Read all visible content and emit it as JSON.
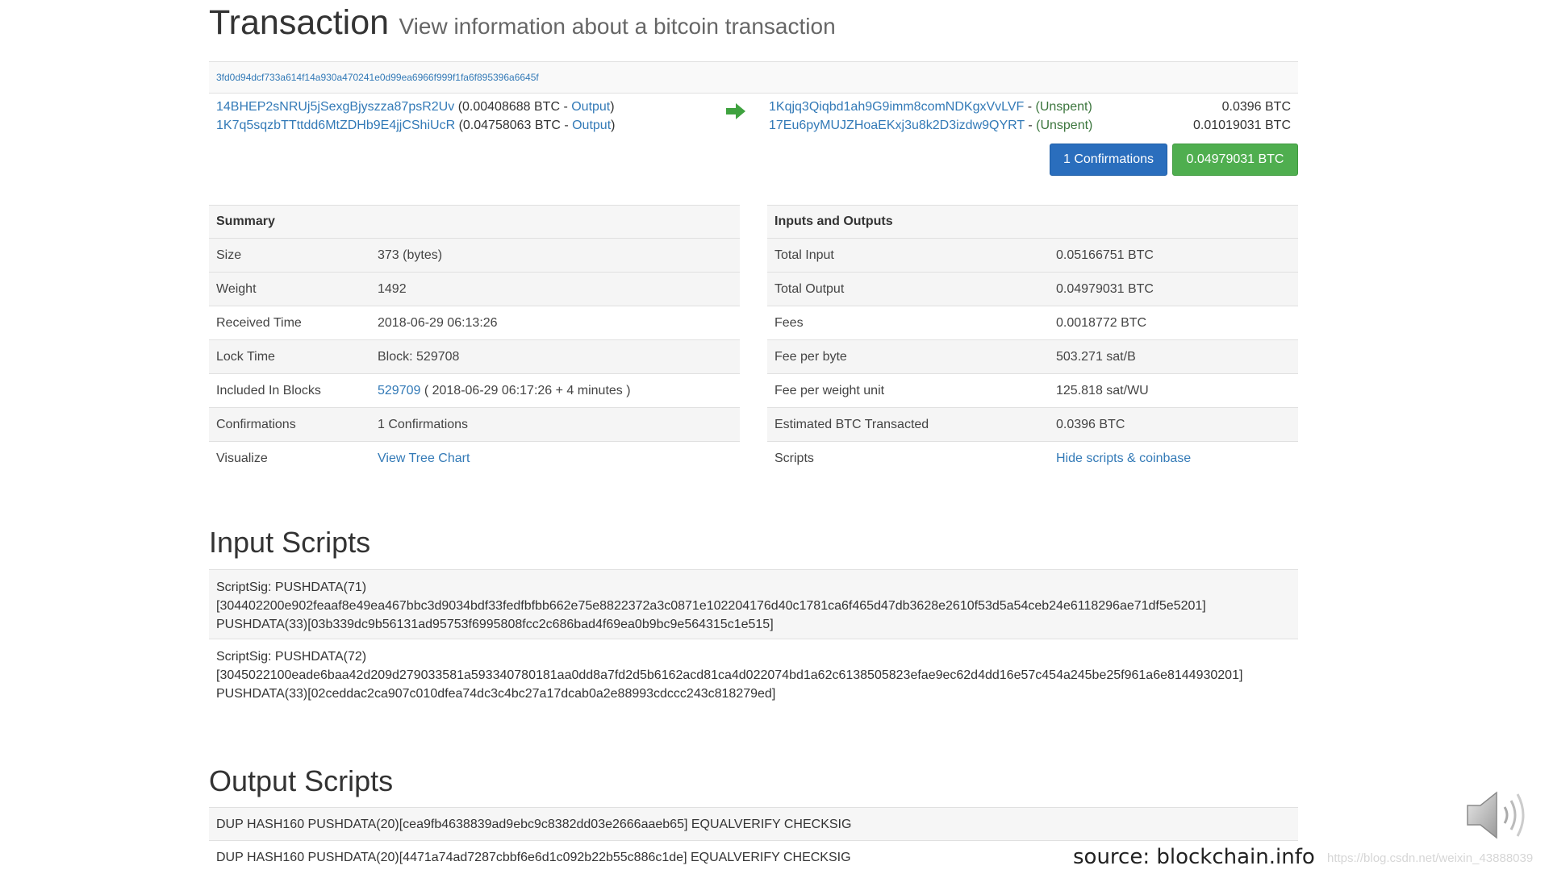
{
  "header": {
    "title": "Transaction",
    "subtitle": "View information about a bitcoin transaction"
  },
  "tx": {
    "hash": "3fd0d94dcf733a614f14a930a470241e0d99ea6966f999f1fa6f895396a6645f",
    "inputs": [
      {
        "address": "14BHEP2sNRUj5jSexgBjyszza87psR2Uv",
        "amount_text": "(0.00408688 BTC - ",
        "link_label": "Output",
        "close": ")"
      },
      {
        "address": "1K7q5sqzbTTttdd6MtZDHb9E4jjCShiUcR",
        "amount_text": "(0.04758063 BTC - ",
        "link_label": "Output",
        "close": ")"
      }
    ],
    "outputs": [
      {
        "address": "1Kqjq3Qiqbd1ah9G9imm8comNDKgxVvLVF",
        "sep": " - ",
        "status": "(Unspent)",
        "amount": "0.0396 BTC"
      },
      {
        "address": "17Eu6pyMUJZHoaEKxj3u8k2D3izdw9QYRT",
        "sep": " - ",
        "status": "(Unspent)",
        "amount": "0.01019031 BTC"
      }
    ],
    "confirmations_button": "1 Confirmations",
    "total_button": "0.04979031 BTC",
    "arrow_icon": "arrow-right-icon",
    "colors": {
      "primary": "#2a6ebd",
      "success": "#4fae4f",
      "link": "#337ab7",
      "green_text": "#3c763d"
    }
  },
  "summary": {
    "heading": "Summary",
    "rows": [
      {
        "label": "Size",
        "value": "373 (bytes)"
      },
      {
        "label": "Weight",
        "value": "1492"
      },
      {
        "label": "Received Time",
        "value": "2018-06-29 06:13:26"
      },
      {
        "label": "Lock Time",
        "value": "Block: 529708"
      },
      {
        "label": "Included In Blocks",
        "value_link": "529709",
        "value": " ( 2018-06-29 06:17:26 + 4 minutes )"
      },
      {
        "label": "Confirmations",
        "value": "1 Confirmations"
      },
      {
        "label": "Visualize",
        "value_link": "View Tree Chart",
        "value": ""
      }
    ]
  },
  "inputs_outputs": {
    "heading": "Inputs and Outputs",
    "rows": [
      {
        "label": "Total Input",
        "value": "0.05166751 BTC"
      },
      {
        "label": "Total Output",
        "value": "0.04979031 BTC"
      },
      {
        "label": "Fees",
        "value": "0.0018772 BTC"
      },
      {
        "label": "Fee per byte",
        "value": "503.271 sat/B"
      },
      {
        "label": "Fee per weight unit",
        "value": "125.818 sat/WU"
      },
      {
        "label": "Estimated BTC Transacted",
        "value": "0.0396 BTC"
      },
      {
        "label": "Scripts",
        "value_link": "Hide scripts & coinbase",
        "value": ""
      }
    ]
  },
  "input_scripts": {
    "title": "Input Scripts",
    "blocks": [
      {
        "line1": "ScriptSig: PUSHDATA(71)",
        "line2": "[304402200e902feaaf8e49ea467bbc3d9034bdf33fedfbfbb662e75e8822372a3c0871e102204176d40c1781ca6f465d47db3628e2610f53d5a54ceb24e6118296ae71df5e5201]",
        "line3": "PUSHDATA(33)[03b339dc9b56131ad95753f6995808fcc2c686bad4f69ea0b9bc9e564315c1e515]"
      },
      {
        "line1": "ScriptSig: PUSHDATA(72)",
        "line2": "[3045022100eade6baa42d209d279033581a593340780181aa0dd8a7fd2d5b6162acd81ca4d022074bd1a62c6138505823efae9ec62d4dd16e57c454a245be25f961a6e8144930201]",
        "line3": "PUSHDATA(33)[02ceddac2ca907c010dfea74dc3c4bc27a17dcab0a2e88993cdccc243c818279ed]"
      }
    ]
  },
  "output_scripts": {
    "title": "Output Scripts",
    "rows": [
      "DUP HASH160 PUSHDATA(20)[cea9fb4638839ad9ebc9c8382dd03e2666aaeb65] EQUALVERIFY CHECKSIG",
      "DUP HASH160 PUSHDATA(20)[4471a74ad7287cbbf6e6d1c092b22b55c886c1de] EQUALVERIFY CHECKSIG"
    ]
  },
  "footer": {
    "source": "source: blockchain.info",
    "watermark": "https://blog.csdn.net/weixin_43888039",
    "speaker_icon": "speaker-icon"
  }
}
